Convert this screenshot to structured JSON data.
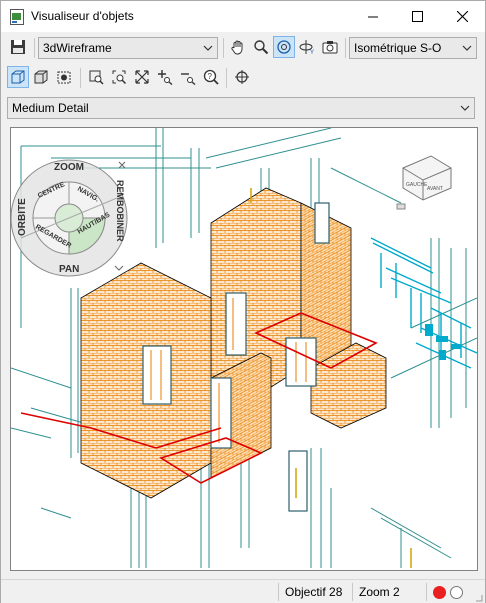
{
  "window": {
    "title": "Visualiseur d'objets"
  },
  "toolbar1": {
    "visual_style": "3dWireframe",
    "view": "Isométrique S-O"
  },
  "toolbar3": {
    "detail": "Medium Detail"
  },
  "navwheel": {
    "zoom": "ZOOM",
    "orbit": "ORBITE",
    "rewind": "REMBOBINER",
    "pan": "PAN",
    "center": "CENTRE",
    "walk": "NAVIG.",
    "look": "REGARDER",
    "updown": "HAUT/BAS"
  },
  "viewcube": {
    "face_left": "GAUCHE",
    "face_front": "AVANT"
  },
  "status": {
    "lens": "Objectif 28",
    "zoom": "Zoom 2"
  },
  "colors": {
    "brick": "#e87d00",
    "cyan": "#00aacc",
    "teal": "#2f8f8f",
    "red": "#dd0000",
    "accent": "#cce4f7"
  }
}
